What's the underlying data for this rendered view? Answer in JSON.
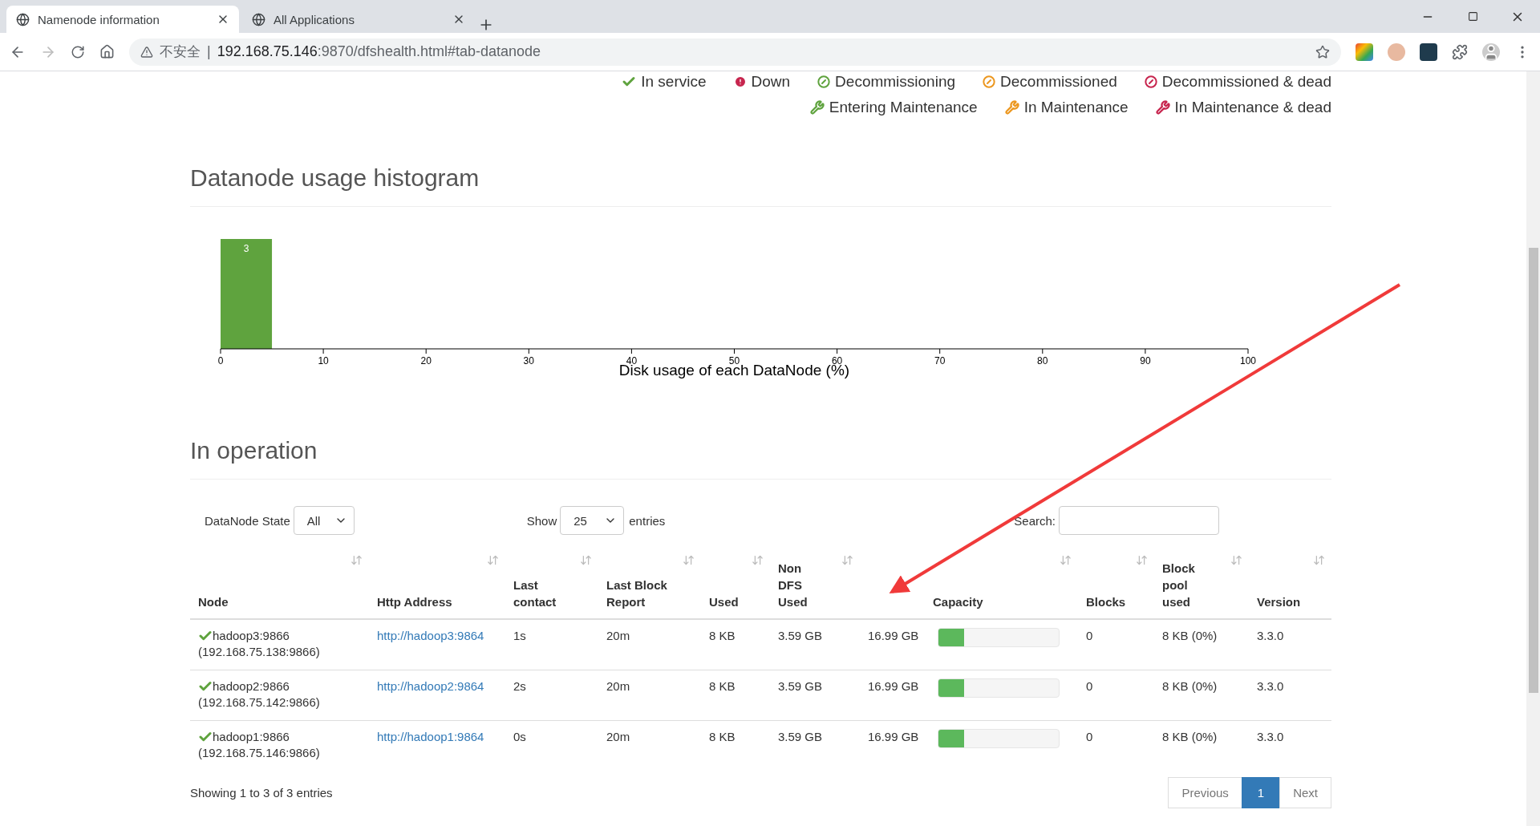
{
  "browser": {
    "tabs": [
      {
        "title": "Namenode information",
        "selected": true
      },
      {
        "title": "All Applications",
        "selected": false
      }
    ],
    "address": {
      "security_label": "不安全",
      "separator": "|",
      "host": "192.168.75.146",
      "path": ":9870/dfshealth.html#tab-datanode"
    }
  },
  "legend": [
    {
      "label": "In service",
      "kind": "check",
      "color": "#5fa33e"
    },
    {
      "label": "Down",
      "kind": "down",
      "color": "#c7254e"
    },
    {
      "label": "Decommissioning",
      "kind": "decom",
      "color": "#5fa33e"
    },
    {
      "label": "Decommissioned",
      "kind": "decom",
      "color": "#ec971f"
    },
    {
      "label": "Decommissioned & dead",
      "kind": "decom",
      "color": "#c7254e"
    },
    {
      "label": "Entering Maintenance",
      "kind": "wrench",
      "color": "#5fa33e"
    },
    {
      "label": "In Maintenance",
      "kind": "wrench",
      "color": "#ec971f"
    },
    {
      "label": "In Maintenance & dead",
      "kind": "wrench",
      "color": "#c7254e"
    }
  ],
  "histogram": {
    "heading": "Datanode usage histogram",
    "chart_data": {
      "type": "bar",
      "xlabel": "Disk usage of each DataNode (%)",
      "x": [
        2.5
      ],
      "values": [
        3
      ],
      "xlim": [
        0,
        100
      ],
      "xticks": [
        0,
        10,
        20,
        30,
        40,
        50,
        60,
        70,
        80,
        90,
        100
      ],
      "data_labels": true
    }
  },
  "operation": {
    "heading": "In operation",
    "state_filter": {
      "label": "DataNode State",
      "value": "All"
    },
    "page_size": {
      "label": "Show",
      "value": "25",
      "suffix": "entries"
    },
    "search": {
      "label": "Search:"
    },
    "table": {
      "columns": [
        "Node",
        "Http Address",
        "Last contact",
        "Last Block Report",
        "Used",
        "Non DFS Used",
        "Capacity",
        "Blocks",
        "Block pool used",
        "Version"
      ],
      "rows": [
        {
          "kind": "in_service",
          "node": "hadoop3:9866",
          "ip": "(192.168.75.138:9866)",
          "http": "http://hadoop3:9864",
          "last_contact": "1s",
          "last_block_report": "20m",
          "used": "8 KB",
          "non_dfs_used": "3.59 GB",
          "capacity": "16.99 GB",
          "level": 0.21,
          "blocks": "0",
          "block_pool_used": "8 KB (0%)",
          "version": "3.3.0"
        },
        {
          "kind": "in_service",
          "node": "hadoop2:9866",
          "ip": "(192.168.75.142:9866)",
          "http": "http://hadoop2:9864",
          "last_contact": "2s",
          "last_block_report": "20m",
          "used": "8 KB",
          "non_dfs_used": "3.59 GB",
          "capacity": "16.99 GB",
          "level": 0.21,
          "blocks": "0",
          "block_pool_used": "8 KB (0%)",
          "version": "3.3.0"
        },
        {
          "kind": "in_service",
          "node": "hadoop1:9866",
          "ip": "(192.168.75.146:9866)",
          "http": "http://hadoop1:9864",
          "last_contact": "0s",
          "last_block_report": "20m",
          "used": "8 KB",
          "non_dfs_used": "3.59 GB",
          "capacity": "16.99 GB",
          "level": 0.21,
          "blocks": "0",
          "block_pool_used": "8 KB (0%)",
          "version": "3.3.0"
        }
      ]
    },
    "info": "Showing 1 to 3 of 3 entries",
    "pagination": [
      {
        "label": "Previous",
        "selected": false
      },
      {
        "label": "1",
        "selected": true
      },
      {
        "label": "Next",
        "selected": false
      }
    ]
  }
}
